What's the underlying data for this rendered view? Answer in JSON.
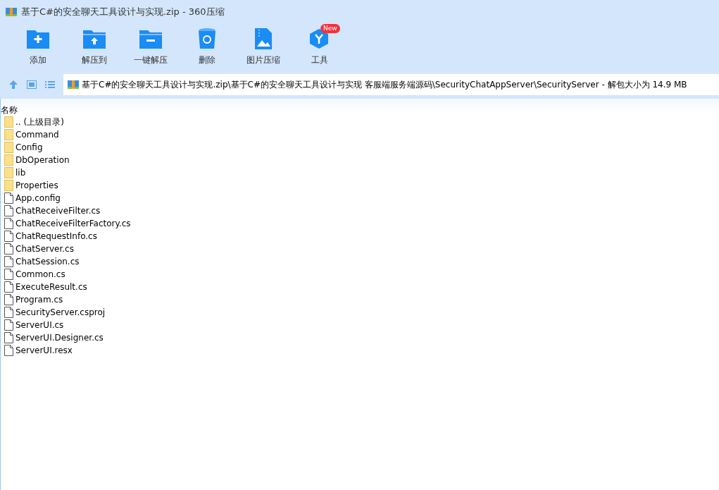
{
  "window": {
    "title": "基于C#的安全聊天工具设计与实现.zip - 360压缩"
  },
  "toolbar": [
    {
      "kind": "add",
      "label": "添加"
    },
    {
      "kind": "extract",
      "label": "解压到"
    },
    {
      "kind": "oneclick",
      "label": "一键解压"
    },
    {
      "kind": "delete",
      "label": "删除"
    },
    {
      "kind": "image",
      "label": "图片压缩"
    },
    {
      "kind": "tools",
      "label": "工具",
      "badge": "New"
    }
  ],
  "address": {
    "path": "基于C#的安全聊天工具设计与实现.zip\\基于C#的安全聊天工具设计与实现 客服端服务端源码\\SecurityChatAppServer\\SecurityServer - 解包大小为 14.9 MB"
  },
  "table": {
    "columns": [
      "名称"
    ],
    "rows": [
      {
        "kind": "folder",
        "name": ".. (上级目录)"
      },
      {
        "kind": "folder",
        "name": "Command"
      },
      {
        "kind": "folder",
        "name": "Config"
      },
      {
        "kind": "folder",
        "name": "DbOperation"
      },
      {
        "kind": "folder",
        "name": "lib"
      },
      {
        "kind": "folder",
        "name": "Properties"
      },
      {
        "kind": "file",
        "name": "App.config"
      },
      {
        "kind": "file",
        "name": "ChatReceiveFilter.cs"
      },
      {
        "kind": "file",
        "name": "ChatReceiveFilterFactory.cs"
      },
      {
        "kind": "file",
        "name": "ChatRequestInfo.cs"
      },
      {
        "kind": "file",
        "name": "ChatServer.cs"
      },
      {
        "kind": "file",
        "name": "ChatSession.cs"
      },
      {
        "kind": "file",
        "name": "Common.cs"
      },
      {
        "kind": "file",
        "name": "ExecuteResult.cs"
      },
      {
        "kind": "file",
        "name": "Program.cs"
      },
      {
        "kind": "file",
        "name": "SecurityServer.csproj"
      },
      {
        "kind": "file",
        "name": "ServerUI.cs"
      },
      {
        "kind": "file",
        "name": "ServerUI.Designer.cs"
      },
      {
        "kind": "file",
        "name": "ServerUI.resx"
      }
    ]
  }
}
